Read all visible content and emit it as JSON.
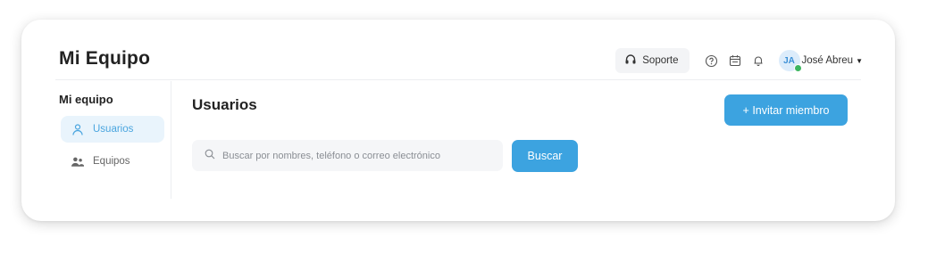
{
  "header": {
    "title": "Mi Equipo",
    "support_label": "Soporte",
    "user": {
      "initials": "JA",
      "name": "José Abreu"
    }
  },
  "sidebar": {
    "title": "Mi equipo",
    "items": [
      {
        "label": "Usuarios",
        "icon": "user-icon",
        "active": true
      },
      {
        "label": "Equipos",
        "icon": "group-icon",
        "active": false
      }
    ]
  },
  "main": {
    "title": "Usuarios",
    "invite_label": "+ Invitar miembro",
    "search": {
      "placeholder": "Buscar por nombres, teléfono o correo electrónico",
      "value": ""
    },
    "search_button": "Buscar"
  },
  "colors": {
    "accent": "#3ca3e0",
    "active_bg": "#e9f4fc",
    "status_online": "#3cb55f"
  }
}
